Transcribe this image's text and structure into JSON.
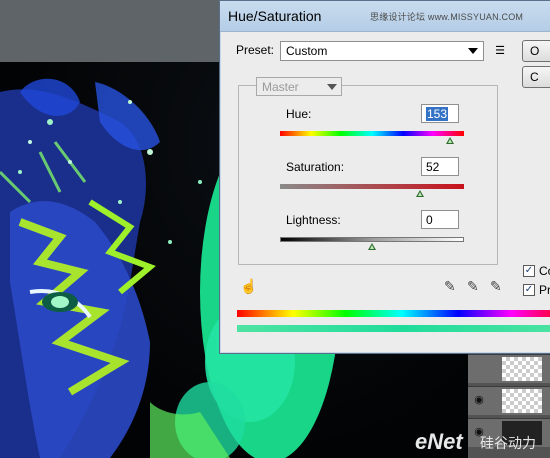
{
  "window": {
    "title": "Hue/Saturation",
    "watermark": "思缘设计论坛 www.MISSYUAN.COM"
  },
  "preset": {
    "label": "Preset:",
    "value": "Custom"
  },
  "buttons": {
    "ok": "O",
    "cancel": "C"
  },
  "channel": {
    "value": "Master"
  },
  "hue": {
    "label": "Hue:",
    "value": "153",
    "level": 153,
    "min": -180,
    "max": 180
  },
  "saturation": {
    "label": "Saturation:",
    "value": "52",
    "level": 52,
    "min": -100,
    "max": 100
  },
  "lightness": {
    "label": "Lightness:",
    "value": "0",
    "level": 0,
    "min": -100,
    "max": 100
  },
  "options": {
    "colorize": "Co",
    "preview": "Pr"
  },
  "footer": {
    "logo": "eNet",
    "logo_cn": "硅谷动力"
  },
  "icons": [
    "preset-menu-icon",
    "hand-tool-icon",
    "eyedropper-icon",
    "eyedropper-plus-icon",
    "eyedropper-minus-icon",
    "eye-icon"
  ],
  "colors": {
    "accent": "#3472c6",
    "slider_thumb": "#2f6d2f"
  }
}
